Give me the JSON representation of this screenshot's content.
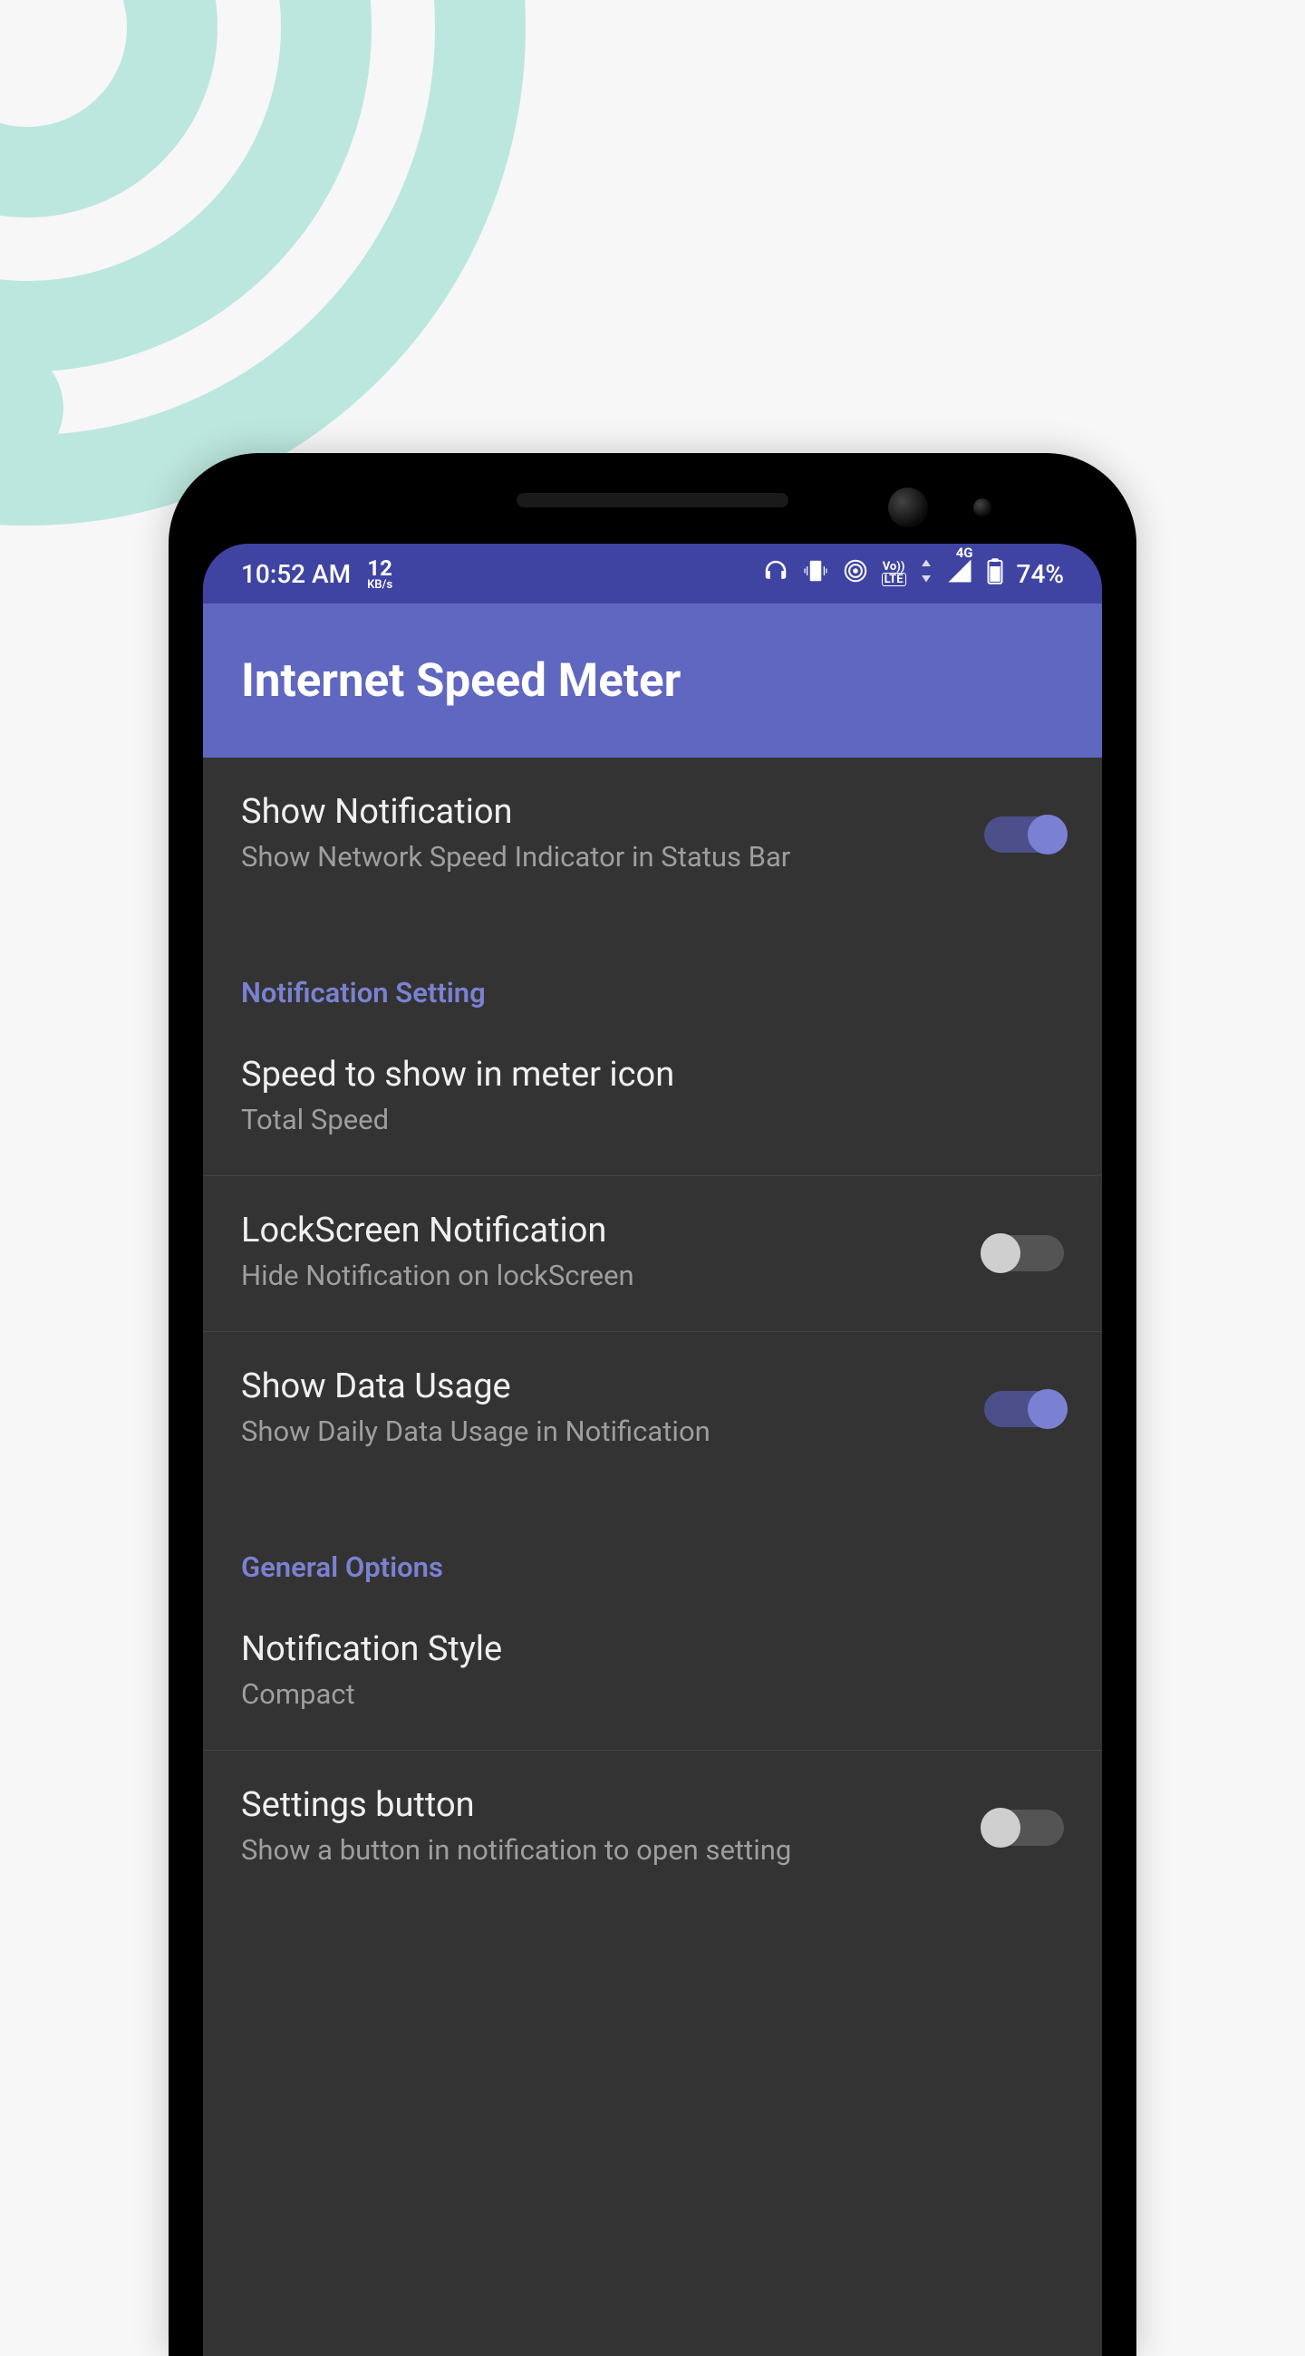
{
  "statusbar": {
    "time": "10:52 AM",
    "speed_value": "12",
    "speed_unit": "KB/s",
    "volte": "VO LTE",
    "network_gen": "4G",
    "battery_pct": "74%"
  },
  "appbar": {
    "title": "Internet Speed Meter"
  },
  "settings": {
    "show_notification": {
      "title": "Show Notification",
      "subtitle": "Show Network Speed Indicator in Status Bar",
      "enabled": true
    },
    "section_notification": "Notification Setting",
    "speed_meter": {
      "title": "Speed to show in meter icon",
      "subtitle": "Total Speed"
    },
    "lockscreen": {
      "title": "LockScreen Notification",
      "subtitle": "Hide Notification on lockScreen",
      "enabled": false
    },
    "data_usage": {
      "title": "Show Data Usage",
      "subtitle": "Show Daily Data Usage in Notification",
      "enabled": true
    },
    "section_general": "General Options",
    "notif_style": {
      "title": "Notification Style",
      "subtitle": "Compact"
    },
    "settings_button": {
      "title": "Settings button",
      "subtitle": "Show a button in notification to open setting",
      "enabled": false
    }
  }
}
